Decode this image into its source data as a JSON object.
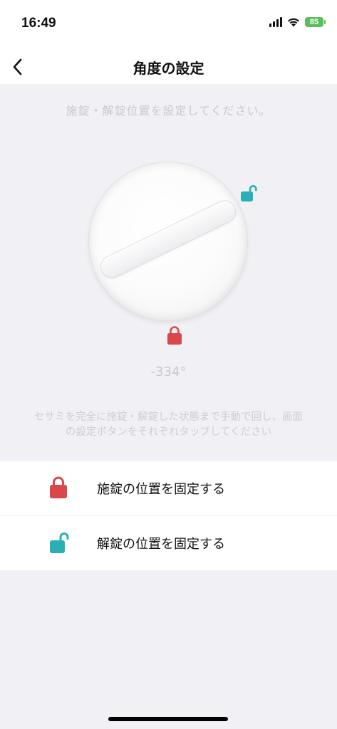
{
  "status_bar": {
    "time": "16:49",
    "battery": "85"
  },
  "nav": {
    "title": "角度の設定"
  },
  "main": {
    "instruction": "施錠・解錠位置を設定してください。",
    "angle": "-334°",
    "hint_line1": "セサミを完全に施錠・解錠した状態まで手動で回し、画面",
    "hint_line2": "の設定ボタンをそれぞれタップしてください"
  },
  "actions": [
    {
      "label": "施錠の位置を固定する",
      "icon": "lock-icon",
      "color": "#d9474a"
    },
    {
      "label": "解錠の位置を固定する",
      "icon": "unlock-icon",
      "color": "#2ab0b4"
    }
  ],
  "colors": {
    "lock": "#d9474a",
    "unlock": "#2ab0b4",
    "background": "#f1f0f5"
  }
}
